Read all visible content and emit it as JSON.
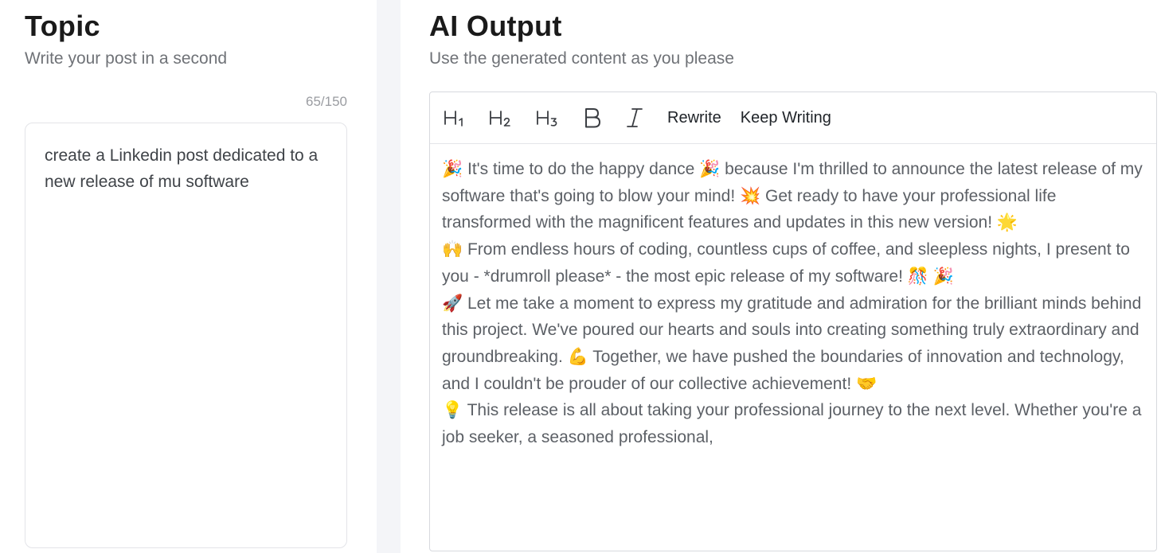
{
  "topic": {
    "title": "Topic",
    "subtitle": "Write your post in a second",
    "counter": "65/150",
    "input_value": "create a Linkedin post dedicated to a new release of mu software"
  },
  "output": {
    "title": "AI Output",
    "subtitle": "Use the generated content as you please",
    "toolbar": {
      "h1": "H1",
      "h2": "H2",
      "h3": "H3",
      "bold": "B",
      "italic": "I",
      "rewrite": "Rewrite",
      "keep_writing": "Keep Writing"
    },
    "paragraphs": [
      "🎉 It's time to do the happy dance 🎉 because I'm thrilled to announce the latest release of my software that's going to blow your mind! 💥 Get ready to have your professional life transformed with the magnificent features and updates in this new version! 🌟",
      "🙌 From endless hours of coding, countless cups of coffee, and sleepless nights, I present to you - *drumroll please* - the most epic release of my software! 🎊 🎉",
      "🚀 Let me take a moment to express my gratitude and admiration for the brilliant minds behind this project. We've poured our hearts and souls into creating something truly extraordinary and groundbreaking. 💪 Together, we have pushed the boundaries of innovation and technology, and I couldn't be prouder of our collective achievement! 🤝",
      "💡 This release is all about taking your professional journey to the next level. Whether you're a job seeker, a seasoned professional,"
    ]
  },
  "colors": {
    "title": "#1a1a1a",
    "subtitle": "#6f7277",
    "body_text": "#5c6066",
    "border": "#d7d9de",
    "gap_background": "#f4f5f8"
  }
}
